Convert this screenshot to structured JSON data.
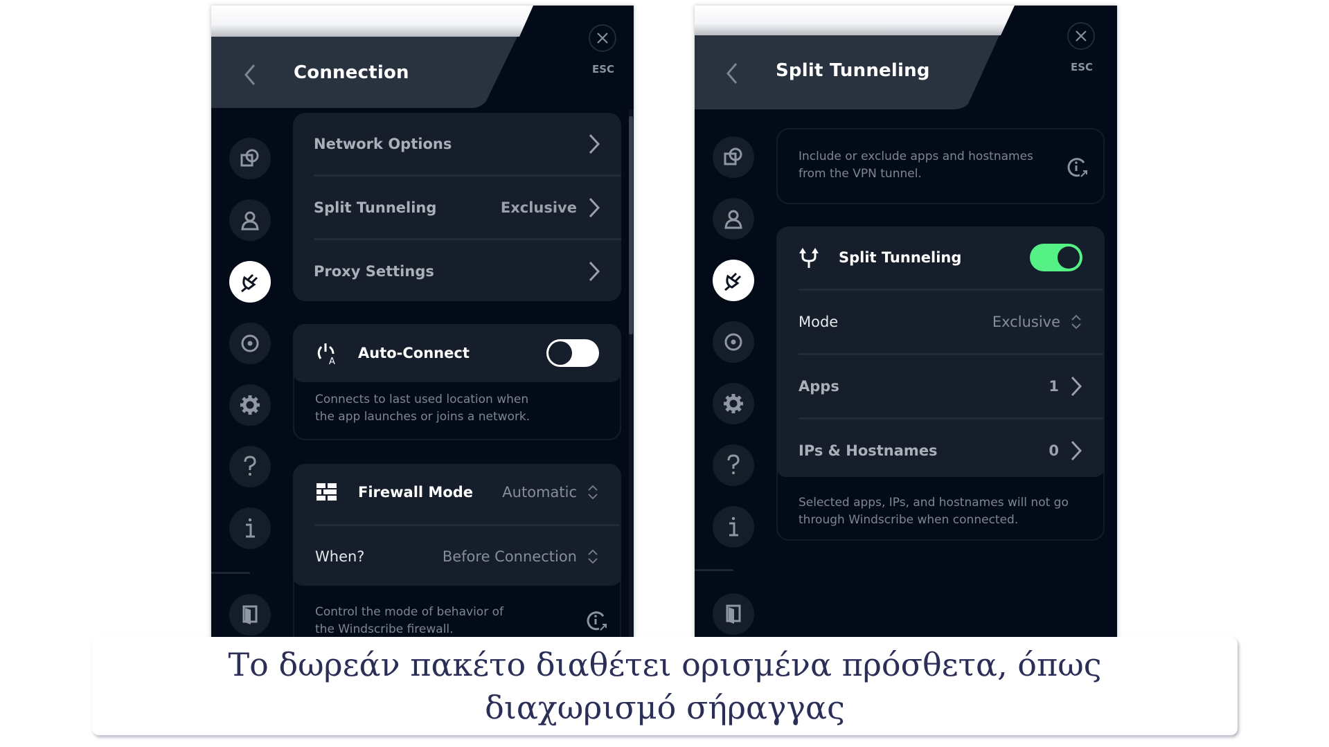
{
  "left_panel": {
    "title": "Connection",
    "esc_label": "ESC",
    "sidebar": [
      {
        "icon": "connection-window-icon",
        "active": false
      },
      {
        "icon": "account-icon",
        "active": false
      },
      {
        "icon": "connection-plug-icon",
        "active": true
      },
      {
        "icon": "robert-icon",
        "active": false
      },
      {
        "icon": "gear-icon",
        "active": false
      },
      {
        "icon": "help-icon",
        "active": false
      },
      {
        "icon": "info-icon",
        "active": false
      },
      {
        "icon": "exit-door-icon",
        "active": false
      }
    ],
    "menu": [
      {
        "label": "Network Options",
        "value": ""
      },
      {
        "label": "Split Tunneling",
        "value": "Exclusive"
      },
      {
        "label": "Proxy Settings",
        "value": ""
      }
    ],
    "auto_connect": {
      "label": "Auto-Connect",
      "enabled": false,
      "description": "Connects to last used location when the app launches or joins a network."
    },
    "firewall": {
      "label": "Firewall Mode",
      "value": "Automatic",
      "when_label": "When?",
      "when_value": "Before Connection",
      "description": "Control the mode of behavior of the Windscribe firewall."
    }
  },
  "right_panel": {
    "title": "Split Tunneling",
    "esc_label": "ESC",
    "info_text": "Include or exclude apps and hostnames from the VPN tunnel.",
    "toggle_label": "Split Tunneling",
    "toggle_enabled": true,
    "mode_label": "Mode",
    "mode_value": "Exclusive",
    "apps_label": "Apps",
    "apps_count": "1",
    "ips_label": "IPs & Hostnames",
    "ips_count": "0",
    "description": "Selected apps, IPs, and hostnames will not go through Windscribe when connected."
  },
  "colors": {
    "panel_bg": "#030b18",
    "card_bg": "#161e2b",
    "header_bg": "#29323f",
    "toggle_on": "#55f086",
    "caption_text": "#2b2f57"
  },
  "caption": "Το δωρεάν πακέτο διαθέτει ορισμένα πρόσθετα, όπως διαχωρισμό σήραγγας"
}
